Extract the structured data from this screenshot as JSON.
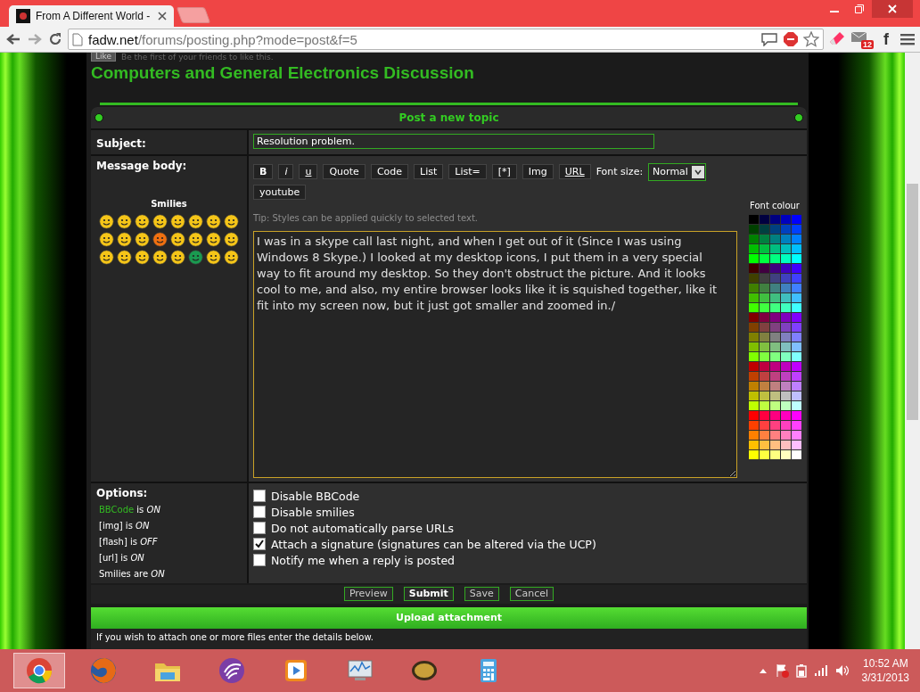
{
  "browser": {
    "tab_title": "From A Different World -",
    "url_domain": "fadw.net",
    "url_path": "/forums/posting.php?mode=post&f=5",
    "extension_badge": "12",
    "facebook_button": "f"
  },
  "like_bar": {
    "button": "Like",
    "text": "Be the first of your friends to like this."
  },
  "forum_title": "Computers and General Electronics Discussion",
  "panel_title": "Post a new topic",
  "subject": {
    "label": "Subject:",
    "value": "Resolution problem."
  },
  "message": {
    "label": "Message body:",
    "smilies_title": "Smilies",
    "smilies": [
      {
        "color": "#f5c518"
      },
      {
        "color": "#f5c518"
      },
      {
        "color": "#f5c518"
      },
      {
        "color": "#f5c518"
      },
      {
        "color": "#f5c518"
      },
      {
        "color": "#f5c518"
      },
      {
        "color": "#f5c518"
      },
      {
        "color": "#f5c518"
      },
      {
        "color": "#f5c518"
      },
      {
        "color": "#f5c518"
      },
      {
        "color": "#f5c518"
      },
      {
        "color": "#f07010"
      },
      {
        "color": "#f5c518"
      },
      {
        "color": "#f5c518"
      },
      {
        "color": "#f5c518"
      },
      {
        "color": "#f5c518"
      },
      {
        "color": "#f5c518"
      },
      {
        "color": "#f5c518"
      },
      {
        "color": "#f5c518"
      },
      {
        "color": "#f5c518"
      },
      {
        "color": "#f5c518"
      },
      {
        "color": "#1a9a50"
      },
      {
        "color": "#f5c518"
      },
      {
        "color": "#f5c518"
      }
    ],
    "format_buttons": [
      {
        "label": "B",
        "kind": "bold"
      },
      {
        "label": "i",
        "kind": "italic"
      },
      {
        "label": "u",
        "kind": "underline"
      },
      {
        "label": "Quote",
        "kind": "plain"
      },
      {
        "label": "Code",
        "kind": "plain"
      },
      {
        "label": "List",
        "kind": "plain"
      },
      {
        "label": "List=",
        "kind": "plain"
      },
      {
        "label": "[*]",
        "kind": "plain"
      },
      {
        "label": "Img",
        "kind": "plain"
      },
      {
        "label": "URL",
        "kind": "underline"
      }
    ],
    "font_size_label": "Font size:",
    "font_size_value": "Normal",
    "extra_buttons": [
      "youtube"
    ],
    "tip": "Tip: Styles can be applied quickly to selected text.",
    "body": "I was in a skype call last night, and when I get out of it (Since I was using Windows 8 Skype.) I looked at my desktop icons, I put them in a very special way to fit around my desktop. So they don't obstruct the picture. And it looks cool to me, and also, my entire browser looks like it is squished together, like it fit into my screen now, but it just got smaller and zoomed in./",
    "palette_title": "Font colour",
    "palette": {
      "rows": [
        {
          "colors": [
            {
              "color": "#000000"
            },
            {
              "color": "#000040"
            },
            {
              "color": "#000080"
            },
            {
              "color": "#0000bf"
            },
            {
              "color": "#0000ff"
            }
          ]
        },
        {
          "colors": [
            {
              "color": "#004000"
            },
            {
              "color": "#004040"
            },
            {
              "color": "#004080"
            },
            {
              "color": "#0040bf"
            },
            {
              "color": "#0040ff"
            }
          ]
        },
        {
          "colors": [
            {
              "color": "#008000"
            },
            {
              "color": "#008040"
            },
            {
              "color": "#008080"
            },
            {
              "color": "#0080bf"
            },
            {
              "color": "#0080ff"
            }
          ]
        },
        {
          "colors": [
            {
              "color": "#00bf00"
            },
            {
              "color": "#00bf40"
            },
            {
              "color": "#00bf80"
            },
            {
              "color": "#00bfbf"
            },
            {
              "color": "#00bfff"
            }
          ]
        },
        {
          "colors": [
            {
              "color": "#00ff00"
            },
            {
              "color": "#00ff40"
            },
            {
              "color": "#00ff80"
            },
            {
              "color": "#00ffbf"
            },
            {
              "color": "#00ffff"
            }
          ]
        },
        {
          "colors": [
            {
              "color": "#400000"
            },
            {
              "color": "#400040"
            },
            {
              "color": "#400080"
            },
            {
              "color": "#4000bf"
            },
            {
              "color": "#4000ff"
            }
          ]
        },
        {
          "colors": [
            {
              "color": "#404000"
            },
            {
              "color": "#404040"
            },
            {
              "color": "#404080"
            },
            {
              "color": "#4040bf"
            },
            {
              "color": "#4040ff"
            }
          ]
        },
        {
          "colors": [
            {
              "color": "#408000"
            },
            {
              "color": "#408040"
            },
            {
              "color": "#408080"
            },
            {
              "color": "#4080bf"
            },
            {
              "color": "#4080ff"
            }
          ]
        },
        {
          "colors": [
            {
              "color": "#40bf00"
            },
            {
              "color": "#40bf40"
            },
            {
              "color": "#40bf80"
            },
            {
              "color": "#40bfbf"
            },
            {
              "color": "#40bfff"
            }
          ]
        },
        {
          "colors": [
            {
              "color": "#40ff00"
            },
            {
              "color": "#40ff40"
            },
            {
              "color": "#40ff80"
            },
            {
              "color": "#40ffbf"
            },
            {
              "color": "#40ffff"
            }
          ]
        },
        {
          "colors": [
            {
              "color": "#800000"
            },
            {
              "color": "#800040"
            },
            {
              "color": "#800080"
            },
            {
              "color": "#8000bf"
            },
            {
              "color": "#8000ff"
            }
          ]
        },
        {
          "colors": [
            {
              "color": "#804000"
            },
            {
              "color": "#804040"
            },
            {
              "color": "#804080"
            },
            {
              "color": "#8040bf"
            },
            {
              "color": "#8040ff"
            }
          ]
        },
        {
          "colors": [
            {
              "color": "#808000"
            },
            {
              "color": "#808040"
            },
            {
              "color": "#808080"
            },
            {
              "color": "#8080bf"
            },
            {
              "color": "#8080ff"
            }
          ]
        },
        {
          "colors": [
            {
              "color": "#80bf00"
            },
            {
              "color": "#80bf40"
            },
            {
              "color": "#80bf80"
            },
            {
              "color": "#80bfbf"
            },
            {
              "color": "#80bfff"
            }
          ]
        },
        {
          "colors": [
            {
              "color": "#80ff00"
            },
            {
              "color": "#80ff40"
            },
            {
              "color": "#80ff80"
            },
            {
              "color": "#80ffbf"
            },
            {
              "color": "#80ffff"
            }
          ]
        },
        {
          "colors": [
            {
              "color": "#bf0000"
            },
            {
              "color": "#bf0040"
            },
            {
              "color": "#bf0080"
            },
            {
              "color": "#bf00bf"
            },
            {
              "color": "#bf00ff"
            }
          ]
        },
        {
          "colors": [
            {
              "color": "#bf4000"
            },
            {
              "color": "#bf4040"
            },
            {
              "color": "#bf4080"
            },
            {
              "color": "#bf40bf"
            },
            {
              "color": "#bf40ff"
            }
          ]
        },
        {
          "colors": [
            {
              "color": "#bf8000"
            },
            {
              "color": "#bf8040"
            },
            {
              "color": "#bf8080"
            },
            {
              "color": "#bf80bf"
            },
            {
              "color": "#bf80ff"
            }
          ]
        },
        {
          "colors": [
            {
              "color": "#bfbf00"
            },
            {
              "color": "#bfbf40"
            },
            {
              "color": "#bfbf80"
            },
            {
              "color": "#bfbfbf"
            },
            {
              "color": "#bfbfff"
            }
          ]
        },
        {
          "colors": [
            {
              "color": "#bfff00"
            },
            {
              "color": "#bfff40"
            },
            {
              "color": "#bfff80"
            },
            {
              "color": "#bfffbf"
            },
            {
              "color": "#bfffff"
            }
          ]
        },
        {
          "colors": [
            {
              "color": "#ff0000"
            },
            {
              "color": "#ff0040"
            },
            {
              "color": "#ff0080"
            },
            {
              "color": "#ff00bf"
            },
            {
              "color": "#ff00ff"
            }
          ]
        },
        {
          "colors": [
            {
              "color": "#ff4000"
            },
            {
              "color": "#ff4040"
            },
            {
              "color": "#ff4080"
            },
            {
              "color": "#ff40bf"
            },
            {
              "color": "#ff40ff"
            }
          ]
        },
        {
          "colors": [
            {
              "color": "#ff8000"
            },
            {
              "color": "#ff8040"
            },
            {
              "color": "#ff8080"
            },
            {
              "color": "#ff80bf"
            },
            {
              "color": "#ff80ff"
            }
          ]
        },
        {
          "colors": [
            {
              "color": "#ffbf00"
            },
            {
              "color": "#ffbf40"
            },
            {
              "color": "#ffbf80"
            },
            {
              "color": "#ffbfbf"
            },
            {
              "color": "#ffbfff"
            }
          ]
        },
        {
          "colors": [
            {
              "color": "#ffff00"
            },
            {
              "color": "#ffff40"
            },
            {
              "color": "#ffff80"
            },
            {
              "color": "#ffffbf"
            },
            {
              "color": "#ffffff"
            }
          ]
        }
      ]
    }
  },
  "options": {
    "title": "Options:",
    "status": [
      {
        "label": "BBCode",
        "link": true,
        "verb": "is",
        "value": "ON"
      },
      {
        "label": "[img]",
        "link": false,
        "verb": "is",
        "value": "ON"
      },
      {
        "label": "[flash]",
        "link": false,
        "verb": "is",
        "value": "OFF"
      },
      {
        "label": "[url]",
        "link": false,
        "verb": "is",
        "value": "ON"
      },
      {
        "label": "Smilies",
        "link": false,
        "verb": "are",
        "value": "ON"
      }
    ],
    "checkboxes": [
      {
        "label": "Disable BBCode",
        "checked": false
      },
      {
        "label": "Disable smilies",
        "checked": false
      },
      {
        "label": "Do not automatically parse URLs",
        "checked": false
      },
      {
        "label": "Attach a signature (signatures can be altered via the UCP)",
        "checked": true
      },
      {
        "label": "Notify me when a reply is posted",
        "checked": false
      }
    ]
  },
  "buttons": [
    {
      "label": "Preview",
      "primary": false
    },
    {
      "label": "Submit",
      "primary": true
    },
    {
      "label": "Save",
      "primary": false
    },
    {
      "label": "Cancel",
      "primary": false
    }
  ],
  "upload": {
    "title": "Upload attachment",
    "text": "If you wish to attach one or more files enter the details below."
  },
  "taskbar": {
    "apps": [
      {
        "kind": "chrome",
        "selected": true
      },
      {
        "kind": "firefox",
        "selected": false
      },
      {
        "kind": "explorer",
        "selected": false
      },
      {
        "kind": "torrent",
        "selected": false
      },
      {
        "kind": "media",
        "selected": false
      },
      {
        "kind": "monitor",
        "selected": false
      },
      {
        "kind": "game",
        "selected": false
      },
      {
        "kind": "calculator",
        "selected": false
      }
    ],
    "time": "10:52 AM",
    "date": "3/31/2013"
  }
}
